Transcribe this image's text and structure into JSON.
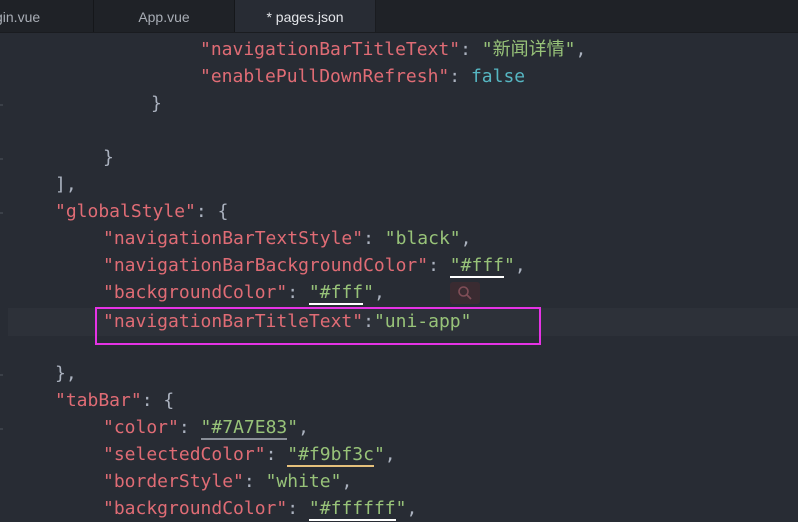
{
  "tabs": [
    {
      "label": "gin.vue"
    },
    {
      "label": "App.vue"
    },
    {
      "label": "* pages.json"
    }
  ],
  "code": {
    "l1_key": "\"navigationBarTitleText\"",
    "l1_val": "\"新闻详情\"",
    "l2_key": "\"enablePullDownRefresh\"",
    "l2_val": "false",
    "l3": "}",
    "l4": "}",
    "l5": "],",
    "l6_key": "\"globalStyle\"",
    "l6_rest": ": {",
    "l7_key": "\"navigationBarTextStyle\"",
    "l7_val": "\"black\"",
    "l8_key": "\"navigationBarBackgroundColor\"",
    "l8_q1": "\"",
    "l8_val": "#fff",
    "l8_q2": "\"",
    "l9_key": "\"backgroundColor\"",
    "l9_q1": "\"",
    "l9_val": "#fff",
    "l9_q2": "\"",
    "l10_key": "\"navigationBarTitleText\"",
    "l10_val": "\"uni-app\"",
    "l11": "},",
    "l12_key": "\"tabBar\"",
    "l12_rest": ": {",
    "l13_key": "\"color\"",
    "l13_q1": "\"",
    "l13_val": "#7A7E83",
    "l13_q2": "\"",
    "l14_key": "\"selectedColor\"",
    "l14_q1": "\"",
    "l14_val": "#f9bf3c",
    "l14_q2": "\"",
    "l15_key": "\"borderStyle\"",
    "l15_val": "\"white\"",
    "l16_key": "\"backgroundColor\"",
    "l16_q1": "\"",
    "l16_val": "#ffffff",
    "l16_q2": "\""
  },
  "colors": {
    "key": "#e06c75",
    "string": "#98c379",
    "boolean": "#56b6c2",
    "highlight_box": "#e533e5"
  },
  "icons": [
    "search-icon"
  ]
}
